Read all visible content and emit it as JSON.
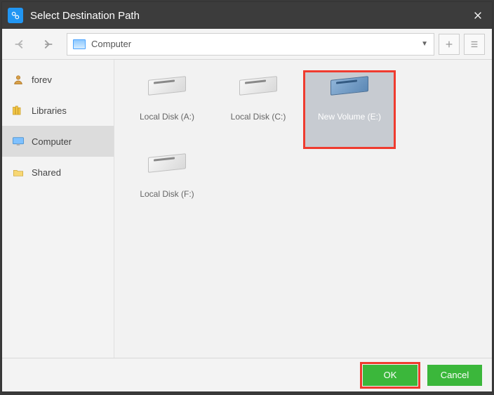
{
  "title": "Select Destination Path",
  "path": {
    "location": "Computer"
  },
  "sidebar": {
    "items": [
      {
        "label": "forev"
      },
      {
        "label": "Libraries"
      },
      {
        "label": "Computer"
      },
      {
        "label": "Shared"
      }
    ]
  },
  "drives": [
    {
      "label": "Local Disk (A:)"
    },
    {
      "label": "Local Disk (C:)"
    },
    {
      "label": "New Volume (E:)"
    },
    {
      "label": "Local Disk (F:)"
    }
  ],
  "buttons": {
    "ok": "OK",
    "cancel": "Cancel"
  }
}
